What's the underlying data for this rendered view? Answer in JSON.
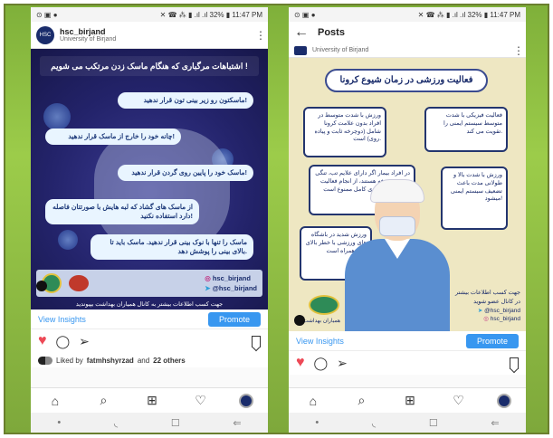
{
  "colors": {
    "accent": "#3897f0",
    "like": "#ed4956",
    "background_grass": "#8bbf3f",
    "brand_navy": "#1a2c6b"
  },
  "left": {
    "status": {
      "icons": "⊙ ▣ ●",
      "right": "✕ ☎ ⁂ ▮ .ıl .ıl 32% ▮ 11:47 PM"
    },
    "header": {
      "username": "hsc_birjand",
      "subtitle": "University of Birjand",
      "menu_icon": "kebab-icon"
    },
    "poster": {
      "title": "اشتباهات مرگباری که هنگام ماسک زدن مرتکب می شویم !",
      "bubbles": [
        "ماسکتون رو زیر بینی تون قرار ندهید!",
        "چانه خود را خارج از ماسک قرار ندهید!",
        "ماسک خود را پایین روی گردن قرار ندهید!",
        "از ماسک های گشاد که لبه هایش با صورتتان فاصله دارد استفاده نکنید!",
        "ماسک را تنها با نوک بینی قرار ندهید. ماسک باید تا بالای بینی را پوشش دهد."
      ],
      "social_instagram": "hsc_birjand",
      "social_telegram": "@hsc_birjand",
      "footer_line": "جهت کسب اطلاعات بیشتر به کانال همیاران بهداشت بپیوندید"
    },
    "insights": {
      "view": "View Insights",
      "promote": "Promote"
    },
    "liked": {
      "prefix": "Liked by",
      "user": "fatmhshyrzad",
      "middle": "and",
      "others": "22 others"
    },
    "nav": {
      "home": "⌂",
      "search": "⌕",
      "add": "⊞",
      "activity": "♡"
    },
    "sysnav": {
      "back": "⇐",
      "recents": "☐",
      "home": "◟"
    }
  },
  "right": {
    "status": {
      "icons": "⊙ ▣ ●",
      "right": "✕ ☎ ⁂ ▮ .ıl .ıl 32% ▮ 11:47 PM"
    },
    "topbar": {
      "back": "←",
      "title": "Posts"
    },
    "subheader": {
      "subtitle": "University of Birjand"
    },
    "poster": {
      "title": "فعالیت ورزشی در زمان شیوع کرونا",
      "cards": [
        "ورزش با شدت متوسط در افراد بدون علامت کرونا شامل (دوچرخه ثابت و پیاده روی) است.",
        "فعالیت فیزیکی با شدت متوسط سیستم ایمنی را تقویت می کند.",
        "در افراد بیمار اگر دارای علایم تب، تنگی نفس و سرفه هستند، از انجام فعالیت فیزیکی تا بهبودی کامل ممنوع است.",
        "ورزش با شدت بالا و طولانی مدت باعث تضعیف سیستم ایمنی میشود!",
        "ورزش شدید در باشگاه های ورزشی با خطر بالای ابتلا همراه است."
      ],
      "info_title": "جهت کسب اطلاعات بیشتر در کانال عضو شوید",
      "telegram": "@hsc_birjand",
      "instagram": "hsc_birjand",
      "logo_text": "همیاران بهداشت"
    },
    "insights": {
      "view": "View Insights",
      "promote": "Promote"
    },
    "nav": {
      "home": "⌂",
      "search": "⌕",
      "add": "⊞",
      "activity": "♡"
    },
    "sysnav": {
      "back": "⇐",
      "recents": "☐",
      "home": "◟"
    }
  }
}
